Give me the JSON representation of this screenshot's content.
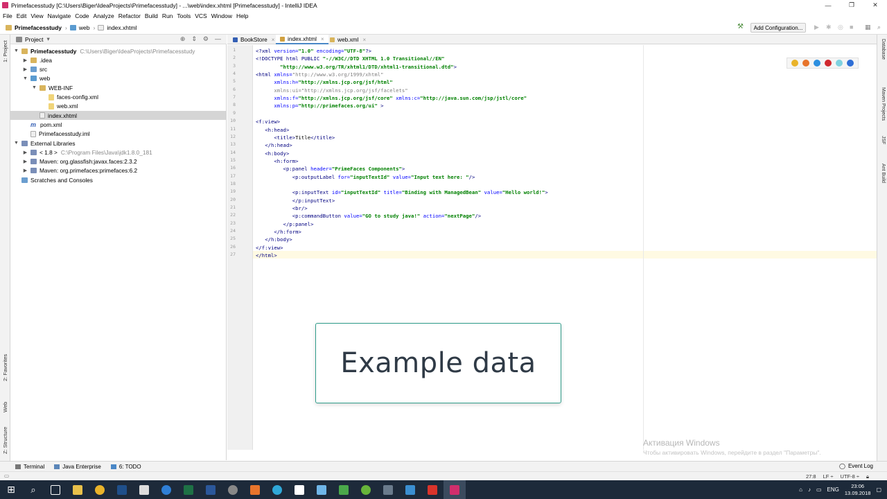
{
  "window": {
    "title": "Primefacesstudy [C:\\Users\\Biger\\IdeaProjects\\Primefacesstudy] - ...\\web\\index.xhtml [Primefacesstudy] - IntelliJ IDEA",
    "controls": [
      "—",
      "❐",
      "✕"
    ]
  },
  "menu": [
    "File",
    "Edit",
    "View",
    "Navigate",
    "Code",
    "Analyze",
    "Refactor",
    "Build",
    "Run",
    "Tools",
    "VCS",
    "Window",
    "Help"
  ],
  "breadcrumb": [
    "Primefacesstudy",
    "web",
    "index.xhtml"
  ],
  "toolbar": {
    "add_config": "Add Configuration..."
  },
  "project_panel": {
    "title": "Project",
    "tree": [
      {
        "label": "Primefacesstudy",
        "hint": "C:\\Users\\Biger\\IdeaProjects\\Primefacesstudy",
        "indent": 0,
        "arrow": "▼",
        "icon": "folder"
      },
      {
        "label": ".idea",
        "hint": "",
        "indent": 1,
        "arrow": "▶",
        "icon": "folder"
      },
      {
        "label": "src",
        "hint": "",
        "indent": 1,
        "arrow": "▶",
        "icon": "src"
      },
      {
        "label": "web",
        "hint": "",
        "indent": 1,
        "arrow": "▼",
        "icon": "web"
      },
      {
        "label": "WEB-INF",
        "hint": "",
        "indent": 2,
        "arrow": "▼",
        "icon": "folder"
      },
      {
        "label": "faces-config.xml",
        "hint": "",
        "indent": 3,
        "arrow": "",
        "icon": "xml"
      },
      {
        "label": "web.xml",
        "hint": "",
        "indent": 3,
        "arrow": "",
        "icon": "xml"
      },
      {
        "label": "index.xhtml",
        "hint": "",
        "indent": 2,
        "arrow": "",
        "icon": "file",
        "selected": true
      },
      {
        "label": "pom.xml",
        "hint": "",
        "indent": 1,
        "arrow": "",
        "icon": "m"
      },
      {
        "label": "Primefacesstudy.iml",
        "hint": "",
        "indent": 1,
        "arrow": "",
        "icon": "file"
      },
      {
        "label": "External Libraries",
        "hint": "",
        "indent": 0,
        "arrow": "▼",
        "icon": "lib"
      },
      {
        "label": "< 1.8 >",
        "hint": "C:\\Program Files\\Java\\jdk1.8.0_181",
        "indent": 1,
        "arrow": "▶",
        "icon": "lib"
      },
      {
        "label": "Maven: org.glassfish:javax.faces:2.3.2",
        "hint": "",
        "indent": 1,
        "arrow": "▶",
        "icon": "lib"
      },
      {
        "label": "Maven: org.primefaces:primefaces:6.2",
        "hint": "",
        "indent": 1,
        "arrow": "▶",
        "icon": "lib"
      },
      {
        "label": "Scratches and Consoles",
        "hint": "",
        "indent": 0,
        "arrow": "",
        "icon": "src"
      }
    ]
  },
  "tabs": [
    {
      "label": "BookStore",
      "active": false
    },
    {
      "label": "index.xhtml",
      "active": true
    },
    {
      "label": "web.xml",
      "active": false
    }
  ],
  "code_lines": [
    [
      [
        "tag",
        "<?xml "
      ],
      [
        "atn",
        "version="
      ],
      [
        "atv",
        "\"1.0\" "
      ],
      [
        "atn",
        "encoding="
      ],
      [
        "atv",
        "\"UTF-8\""
      ],
      [
        "tag",
        "?>"
      ]
    ],
    [
      [
        "tag",
        "<!DOCTYPE html PUBLIC "
      ],
      [
        "atv",
        "\"-//W3C//DTD XHTML 1.0 Transitional//EN\""
      ]
    ],
    [
      [
        "txt",
        "        "
      ],
      [
        "atv",
        "\"http://www.w3.org/TR/xhtml1/DTD/xhtml1-transitional.dtd\""
      ],
      [
        "tag",
        ">"
      ]
    ],
    [
      [
        "tag",
        "<html "
      ],
      [
        "atn",
        "xmlns="
      ],
      [
        "gray",
        "\"http://www.w3.org/1999/xhtml\""
      ]
    ],
    [
      [
        "txt",
        "      "
      ],
      [
        "atn",
        "xmlns:h="
      ],
      [
        "atv",
        "\"http://xmlns.jcp.org/jsf/html\""
      ]
    ],
    [
      [
        "txt",
        "      "
      ],
      [
        "gray",
        "xmlns:ui=\"http://xmlns.jcp.org/jsf/facelets\""
      ]
    ],
    [
      [
        "txt",
        "      "
      ],
      [
        "atn",
        "xmlns:f="
      ],
      [
        "atv",
        "\"http://xmlns.jcp.org/jsf/core\" "
      ],
      [
        "atn",
        "xmlns:c="
      ],
      [
        "atv",
        "\"http://java.sun.com/jsp/jstl/core\""
      ]
    ],
    [
      [
        "txt",
        "      "
      ],
      [
        "atn",
        "xmlns:p="
      ],
      [
        "atv",
        "\"http://primefaces.org/ui\" "
      ],
      [
        "tag",
        ">"
      ]
    ],
    [],
    [
      [
        "tag",
        "<f:view>"
      ]
    ],
    [
      [
        "txt",
        "   "
      ],
      [
        "tag",
        "<h:head>"
      ]
    ],
    [
      [
        "txt",
        "      "
      ],
      [
        "tag",
        "<title>"
      ],
      [
        "txt",
        "Title"
      ],
      [
        "tag",
        "</title>"
      ]
    ],
    [
      [
        "txt",
        "   "
      ],
      [
        "tag",
        "</h:head>"
      ]
    ],
    [
      [
        "txt",
        "   "
      ],
      [
        "tag",
        "<h:body>"
      ]
    ],
    [
      [
        "txt",
        "      "
      ],
      [
        "tag",
        "<h:form>"
      ]
    ],
    [
      [
        "txt",
        "         "
      ],
      [
        "tag",
        "<p:panel "
      ],
      [
        "atn",
        "header="
      ],
      [
        "atv",
        "\"PrimeFaces Components\""
      ],
      [
        "tag",
        ">"
      ]
    ],
    [
      [
        "txt",
        "            "
      ],
      [
        "tag",
        "<p:outputLabel "
      ],
      [
        "atn",
        "for="
      ],
      [
        "atv",
        "\"inputTextId\" "
      ],
      [
        "atn",
        "value="
      ],
      [
        "atv",
        "\"Input text here: \""
      ],
      [
        "tag",
        "/>"
      ]
    ],
    [],
    [
      [
        "txt",
        "            "
      ],
      [
        "tag",
        "<p:inputText "
      ],
      [
        "atn",
        "id="
      ],
      [
        "atv",
        "\"inputTextId\" "
      ],
      [
        "atn",
        "title="
      ],
      [
        "atv",
        "\"Binding with ManagedBean\" "
      ],
      [
        "atn",
        "value="
      ],
      [
        "atv",
        "\"Hello world!\""
      ],
      [
        "tag",
        ">"
      ]
    ],
    [
      [
        "txt",
        "            "
      ],
      [
        "tag",
        "</p:inputText>"
      ]
    ],
    [
      [
        "txt",
        "            "
      ],
      [
        "tag",
        "<br/>"
      ]
    ],
    [
      [
        "txt",
        "            "
      ],
      [
        "tag",
        "<p:commandButton "
      ],
      [
        "atn",
        "value="
      ],
      [
        "atv",
        "\"GO to study java!\" "
      ],
      [
        "atn",
        "action="
      ],
      [
        "atv",
        "\"nextPage\""
      ],
      [
        "tag",
        "/>"
      ]
    ],
    [
      [
        "txt",
        "         "
      ],
      [
        "tag",
        "</p:panel>"
      ]
    ],
    [
      [
        "txt",
        "      "
      ],
      [
        "tag",
        "</h:form>"
      ]
    ],
    [
      [
        "txt",
        "   "
      ],
      [
        "tag",
        "</h:body>"
      ]
    ],
    [
      [
        "tag",
        "</f:view>"
      ]
    ],
    [
      [
        "tag",
        "</html>"
      ]
    ]
  ],
  "left_strip": [
    "1: Project",
    "2: Favorites",
    "Web",
    "Z: Structure"
  ],
  "right_strip": [
    "Database",
    "Maven Projects",
    "JSF",
    "Ant Build"
  ],
  "bottom_tools": [
    "Terminal",
    "Java Enterprise",
    "6: TODO"
  ],
  "event_log": "Event Log",
  "status": {
    "position": "27:8",
    "line_sep": "LF ÷",
    "encoding": "UTF-8 ÷"
  },
  "overlay_text": "Example data",
  "activation": {
    "line1": "Активация Windows",
    "line2": "Чтобы активировать Windows, перейдите в раздел \"Параметры\"."
  },
  "tray": {
    "lang": "ENG",
    "time": "23:06",
    "date": "13.09.2018"
  },
  "colors": {
    "accent": "#4a88c7",
    "selection": "#d5d5d5",
    "tag": "#000080",
    "attr_name": "#0000ff",
    "attr_value": "#008000",
    "taskbar": "#1d2a3a",
    "overlay_border": "#2f9c8a"
  }
}
